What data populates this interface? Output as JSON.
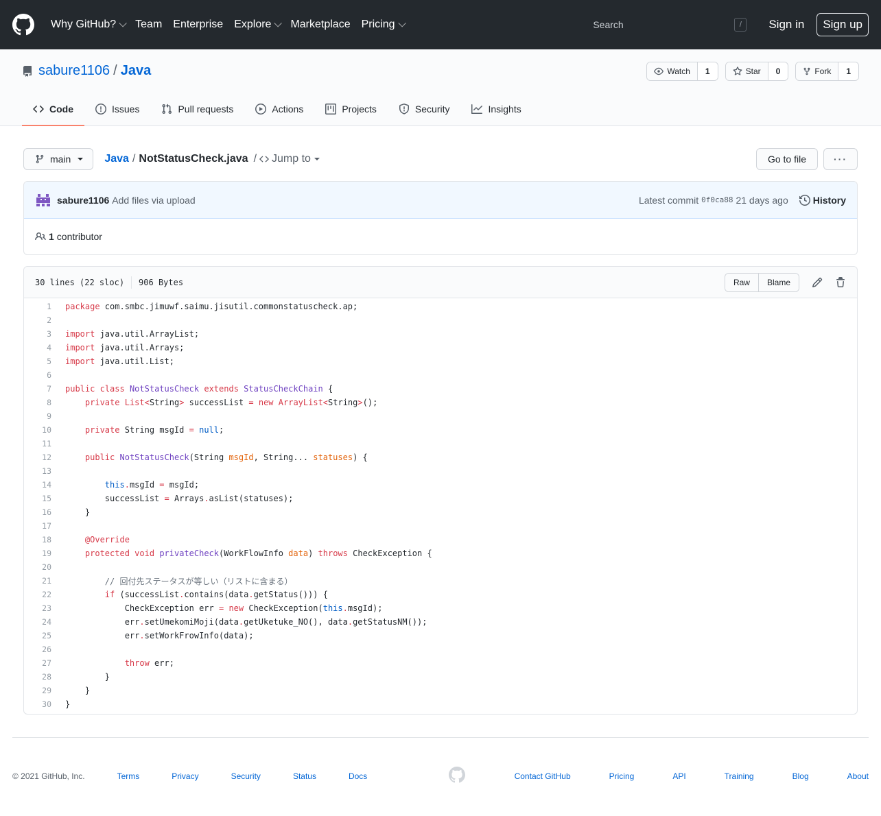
{
  "header": {
    "nav": [
      "Why GitHub?",
      "Team",
      "Enterprise",
      "Explore",
      "Marketplace",
      "Pricing"
    ],
    "nav_has_caret": [
      true,
      false,
      false,
      true,
      false,
      true
    ],
    "search_placeholder": "Search",
    "search_key": "/",
    "sign_in": "Sign in",
    "sign_up": "Sign up"
  },
  "repo": {
    "owner": "sabure1106",
    "sep": "/",
    "name": "Java",
    "watch": {
      "label": "Watch",
      "count": "1"
    },
    "star": {
      "label": "Star",
      "count": "0"
    },
    "fork": {
      "label": "Fork",
      "count": "1"
    },
    "tabs": [
      {
        "label": "Code",
        "icon": "code-icon"
      },
      {
        "label": "Issues",
        "icon": "issue-icon"
      },
      {
        "label": "Pull requests",
        "icon": "pull-request-icon"
      },
      {
        "label": "Actions",
        "icon": "play-icon"
      },
      {
        "label": "Projects",
        "icon": "project-icon"
      },
      {
        "label": "Security",
        "icon": "shield-icon"
      },
      {
        "label": "Insights",
        "icon": "graph-icon"
      }
    ]
  },
  "filenav": {
    "branch": "main",
    "root": "Java",
    "sep": "/",
    "file": "NotStatusCheck.java",
    "jump_sep": "/",
    "jump": "Jump to",
    "go_to_file": "Go to file",
    "more": "···"
  },
  "commit": {
    "author": "sabure1106",
    "message": "Add files via upload",
    "latest_label": "Latest commit",
    "sha": "0f0ca88",
    "time": "21 days ago",
    "history": "History",
    "contributors_count": "1",
    "contributors_label": "contributor"
  },
  "file": {
    "lines_info": "30 lines (22 sloc)",
    "size": "906 Bytes",
    "raw": "Raw",
    "blame": "Blame"
  },
  "colors": {
    "keyword": "#d73a49",
    "type": "#6f42c1",
    "constant": "#005cc5",
    "param": "#e36209",
    "comment": "#6a737d",
    "text": "#24292e"
  },
  "code_lines": [
    [
      [
        "k",
        "package"
      ],
      [
        "t",
        " com.smbc.jimuwf.saimu.jisutil.commonstatuscheck.ap;"
      ]
    ],
    [],
    [
      [
        "k",
        "import"
      ],
      [
        "t",
        " java.util.ArrayList;"
      ]
    ],
    [
      [
        "k",
        "import"
      ],
      [
        "t",
        " java.util.Arrays;"
      ]
    ],
    [
      [
        "k",
        "import"
      ],
      [
        "t",
        " java.util.List;"
      ]
    ],
    [],
    [
      [
        "k",
        "public"
      ],
      [
        "t",
        " "
      ],
      [
        "k",
        "class"
      ],
      [
        "t",
        " "
      ],
      [
        "e",
        "NotStatusCheck"
      ],
      [
        "t",
        " "
      ],
      [
        "k",
        "extends"
      ],
      [
        "t",
        " "
      ],
      [
        "e",
        "StatusCheckChain"
      ],
      [
        "t",
        " {"
      ]
    ],
    [
      [
        "t",
        "    "
      ],
      [
        "k",
        "private"
      ],
      [
        "t",
        " "
      ],
      [
        "k",
        "List"
      ],
      [
        "k",
        "<"
      ],
      [
        "t",
        "String"
      ],
      [
        "k",
        ">"
      ],
      [
        "t",
        " successList "
      ],
      [
        "k",
        "="
      ],
      [
        "t",
        " "
      ],
      [
        "k",
        "new"
      ],
      [
        "t",
        " "
      ],
      [
        "k",
        "ArrayList"
      ],
      [
        "k",
        "<"
      ],
      [
        "t",
        "String"
      ],
      [
        "k",
        ">"
      ],
      [
        "t",
        "();"
      ]
    ],
    [],
    [
      [
        "t",
        "    "
      ],
      [
        "k",
        "private"
      ],
      [
        "t",
        " String msgId "
      ],
      [
        "k",
        "="
      ],
      [
        "t",
        " "
      ],
      [
        "c",
        "null"
      ],
      [
        "t",
        ";"
      ]
    ],
    [],
    [
      [
        "t",
        "    "
      ],
      [
        "k",
        "public"
      ],
      [
        "t",
        " "
      ],
      [
        "e",
        "NotStatusCheck"
      ],
      [
        "t",
        "(String "
      ],
      [
        "v",
        "msgId"
      ],
      [
        "t",
        ", String... "
      ],
      [
        "v",
        "statuses"
      ],
      [
        "t",
        ") {"
      ]
    ],
    [],
    [
      [
        "t",
        "        "
      ],
      [
        "c",
        "this"
      ],
      [
        "k",
        "."
      ],
      [
        "t",
        "msgId "
      ],
      [
        "k",
        "="
      ],
      [
        "t",
        " msgId;"
      ]
    ],
    [
      [
        "t",
        "        successList "
      ],
      [
        "k",
        "="
      ],
      [
        "t",
        " Arrays"
      ],
      [
        "k",
        "."
      ],
      [
        "t",
        "asList(statuses);"
      ]
    ],
    [
      [
        "t",
        "    }"
      ]
    ],
    [],
    [
      [
        "t",
        "    "
      ],
      [
        "k",
        "@Override"
      ]
    ],
    [
      [
        "t",
        "    "
      ],
      [
        "k",
        "protected"
      ],
      [
        "t",
        " "
      ],
      [
        "k",
        "void"
      ],
      [
        "t",
        " "
      ],
      [
        "e",
        "privateCheck"
      ],
      [
        "t",
        "(WorkFlowInfo "
      ],
      [
        "v",
        "data"
      ],
      [
        "t",
        ") "
      ],
      [
        "k",
        "throws"
      ],
      [
        "t",
        " CheckException {"
      ]
    ],
    [],
    [
      [
        "t",
        "        "
      ],
      [
        "m",
        "// 回付先ステータスが等しい（リストに含まる）"
      ]
    ],
    [
      [
        "t",
        "        "
      ],
      [
        "k",
        "if"
      ],
      [
        "t",
        " (successList"
      ],
      [
        "k",
        "."
      ],
      [
        "t",
        "contains(data"
      ],
      [
        "k",
        "."
      ],
      [
        "t",
        "getStatus())) {"
      ]
    ],
    [
      [
        "t",
        "            CheckException err "
      ],
      [
        "k",
        "="
      ],
      [
        "t",
        " "
      ],
      [
        "k",
        "new"
      ],
      [
        "t",
        " CheckException("
      ],
      [
        "c",
        "this"
      ],
      [
        "k",
        "."
      ],
      [
        "t",
        "msgId);"
      ]
    ],
    [
      [
        "t",
        "            err"
      ],
      [
        "k",
        "."
      ],
      [
        "t",
        "setUmekomiMoji(data"
      ],
      [
        "k",
        "."
      ],
      [
        "t",
        "getUketuke_NO(), data"
      ],
      [
        "k",
        "."
      ],
      [
        "t",
        "getStatusNM());"
      ]
    ],
    [
      [
        "t",
        "            err"
      ],
      [
        "k",
        "."
      ],
      [
        "t",
        "setWorkFrowInfo(data);"
      ]
    ],
    [],
    [
      [
        "t",
        "            "
      ],
      [
        "k",
        "throw"
      ],
      [
        "t",
        " err;"
      ]
    ],
    [
      [
        "t",
        "        }"
      ]
    ],
    [
      [
        "t",
        "    }"
      ]
    ],
    [
      [
        "t",
        "}"
      ]
    ]
  ],
  "footer": {
    "copyright": "© 2021 GitHub, Inc.",
    "left_links": [
      "Terms",
      "Privacy",
      "Security",
      "Status",
      "Docs"
    ],
    "right_links": [
      "Contact GitHub",
      "Pricing",
      "API",
      "Training",
      "Blog",
      "About"
    ]
  }
}
